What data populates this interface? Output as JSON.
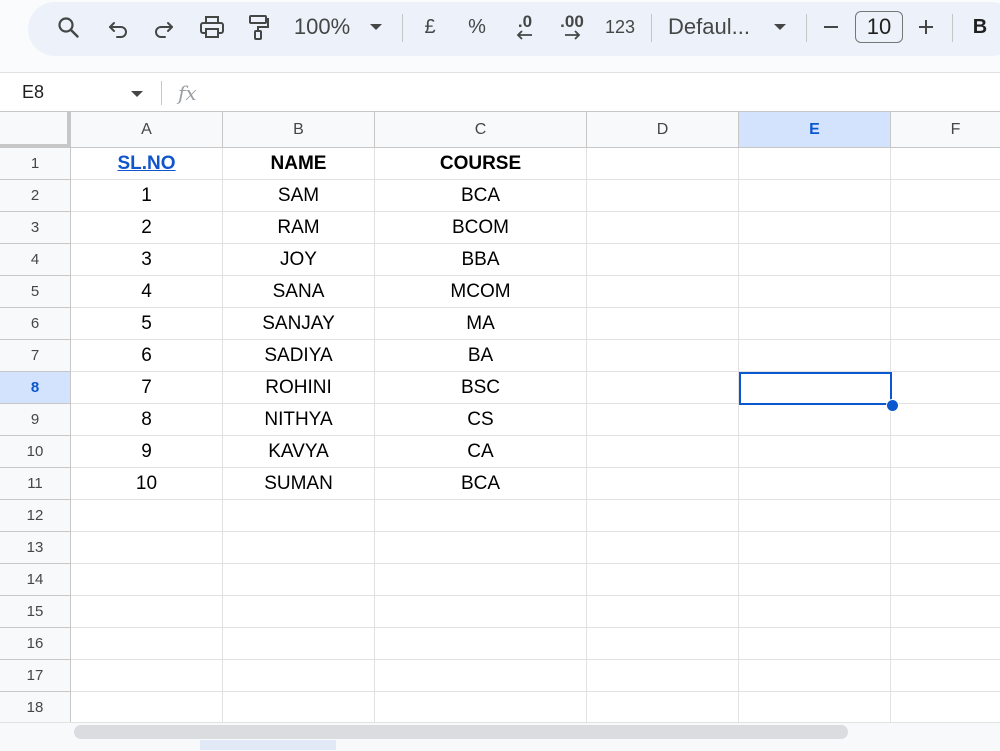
{
  "toolbar": {
    "zoom": "100%",
    "currency_symbol": "£",
    "percent_symbol": "%",
    "decrease_decimal": ".0",
    "increase_decimal": ".00",
    "number_format": "123",
    "font_name": "Defaul...",
    "font_size": "10",
    "bold_label": "B"
  },
  "formula_bar": {
    "name_box": "E8",
    "fx_label": "fx",
    "value": ""
  },
  "sheet": {
    "columns": [
      "A",
      "B",
      "C",
      "D",
      "E",
      "F"
    ],
    "selected_column": "E",
    "selected_row": "8",
    "rows": [
      "1",
      "2",
      "3",
      "4",
      "5",
      "6",
      "7",
      "8",
      "9",
      "10",
      "11",
      "12",
      "13",
      "14",
      "15",
      "16",
      "17",
      "18"
    ],
    "headers": [
      "SL.NO",
      "NAME",
      "COURSE"
    ],
    "data": [
      [
        "1",
        "SAM",
        "BCA"
      ],
      [
        "2",
        "RAM",
        "BCOM"
      ],
      [
        "3",
        "JOY",
        "BBA"
      ],
      [
        "4",
        "SANA",
        "MCOM"
      ],
      [
        "5",
        "SANJAY",
        "MA"
      ],
      [
        "6",
        "SADIYA",
        "BA"
      ],
      [
        "7",
        "ROHINI",
        "BSC"
      ],
      [
        "8",
        "NITHYA",
        "CS"
      ],
      [
        "9",
        "KAVYA",
        "CA"
      ],
      [
        "10",
        "SUMAN",
        "BCA"
      ]
    ]
  },
  "colors": {
    "accent": "#0b57d0",
    "selection_header": "#d3e3fd",
    "link": "#1155cc"
  },
  "icons": [
    "search-icon",
    "undo-icon",
    "redo-icon",
    "print-icon",
    "paint-format-icon",
    "chevron-down-icon",
    "minus-icon",
    "plus-icon"
  ]
}
